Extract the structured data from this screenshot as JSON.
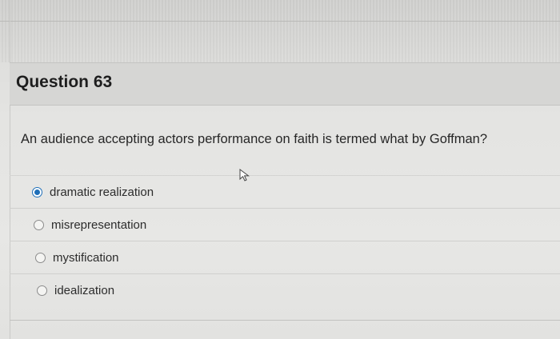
{
  "question": {
    "title": "Question 63",
    "text": "An audience accepting actors performance on faith is termed what by Goffman?"
  },
  "options": [
    {
      "label": "dramatic realization",
      "selected": true
    },
    {
      "label": "misrepresentation",
      "selected": false
    },
    {
      "label": "mystification",
      "selected": false
    },
    {
      "label": "idealization",
      "selected": false
    }
  ],
  "colors": {
    "radio_selected": "#1f6fb8",
    "header_band": "#d6d6d4"
  },
  "icons": {
    "cursor": "mouse-pointer-icon"
  }
}
